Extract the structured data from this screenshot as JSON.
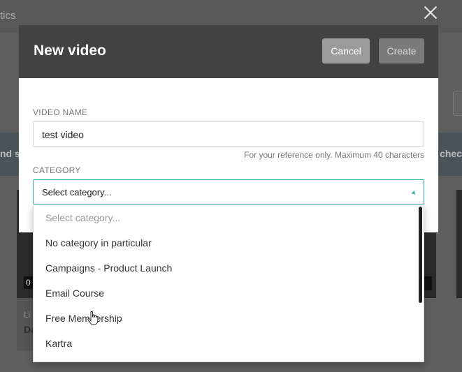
{
  "background": {
    "topbar_text": "tics",
    "banner_left_text": "nd st",
    "banner_right_text": "n chec",
    "card_label_fragment": "Li",
    "card_title_fragment": "Da",
    "card_badge_fragment": "0"
  },
  "modal": {
    "title": "New video",
    "cancel_label": "Cancel",
    "create_label": "Create",
    "video_name_label": "VIDEO NAME",
    "video_name_value": "test video",
    "video_name_hint": "For your reference only. Maximum 40 characters",
    "category_label": "CATEGORY",
    "category_selected": "Select category...",
    "category_options": [
      "Select category...",
      "No category in particular",
      "Campaigns - Product Launch",
      "Email Course",
      "Free Membership",
      "Kartra"
    ]
  },
  "colors": {
    "header_bg": "#424242",
    "accent": "#3aa9a6",
    "overlay": "#5e5e5e"
  }
}
